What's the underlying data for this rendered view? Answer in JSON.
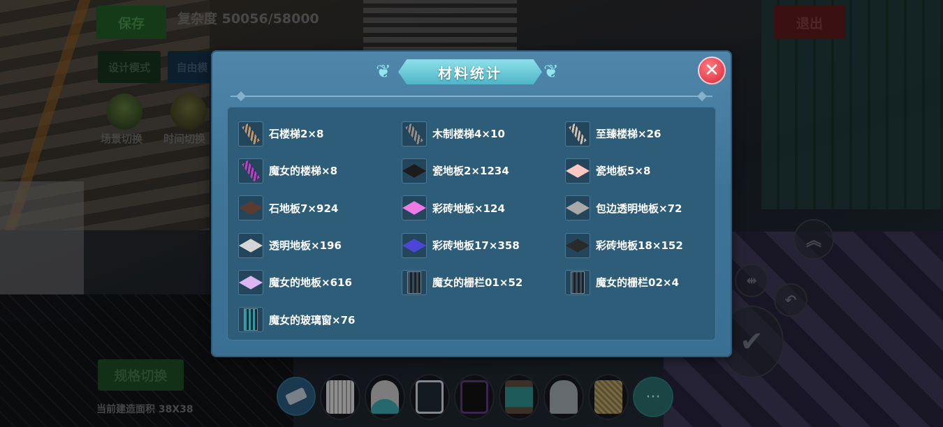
{
  "hud": {
    "save_label": "保存",
    "complexity": "复杂度 50056/58000",
    "exit_label": "退出",
    "design_mode_label": "设计模式",
    "free_mode_label": "自由模",
    "scene_switch_label": "场景切换",
    "time_switch_label": "时间切换",
    "spec_switch_label": "规格切换",
    "build_area": "当前建造面积 38X38"
  },
  "modal": {
    "title": "材料统计",
    "close_symbol": "✕",
    "items": [
      {
        "label": "石楼梯2×8",
        "icon": "stone-stairs",
        "color": "#b89a76"
      },
      {
        "label": "木制楼梯4×10",
        "icon": "wood-stairs",
        "color": "#8f8f8f"
      },
      {
        "label": "至臻楼梯×26",
        "icon": "deluxe-stairs",
        "color": "#c9c2b8"
      },
      {
        "label": "魔女的楼梯×8",
        "icon": "witch-stairs",
        "color": "#c13fd0"
      },
      {
        "label": "瓷地板2×1234",
        "icon": "tile-floor",
        "color": "#1c1c1c"
      },
      {
        "label": "瓷地板5×8",
        "icon": "tile-floor",
        "color": "#ffc7c2"
      },
      {
        "label": "石地板7×924",
        "icon": "stone-floor",
        "color": "#5b3b2f"
      },
      {
        "label": "彩砖地板×124",
        "icon": "color-tile-floor",
        "color": "#ef7ae6"
      },
      {
        "label": "包边透明地板×72",
        "icon": "edged-clear-floor",
        "color": "#a9a9a9"
      },
      {
        "label": "透明地板×196",
        "icon": "clear-floor",
        "color": "#d6d6d6"
      },
      {
        "label": "彩砖地板17×358",
        "icon": "color-tile-floor",
        "color": "#4b46d8"
      },
      {
        "label": "彩砖地板18×152",
        "icon": "color-tile-floor",
        "color": "#2a2a2a"
      },
      {
        "label": "魔女的地板×616",
        "icon": "witch-floor",
        "color": "#dcb6f2"
      },
      {
        "label": "魔女的栅栏01×52",
        "icon": "witch-fence",
        "color": "#3d4a55"
      },
      {
        "label": "魔女的栅栏02×4",
        "icon": "witch-fence",
        "color": "#3d4a55"
      },
      {
        "label": "魔女的玻璃窗×76",
        "icon": "witch-window",
        "color": "#2f9aa5"
      }
    ]
  },
  "toolbar": {
    "items": [
      "eraser",
      "white-fence",
      "arch-window",
      "gothic-window",
      "dark-frame",
      "cabinet",
      "door",
      "gold-panel"
    ],
    "more_symbol": "···"
  },
  "controls": {
    "up_symbol": "︽",
    "mirror_symbol": "⇹",
    "undo_symbol": "↶",
    "confirm_symbol": "✔"
  }
}
